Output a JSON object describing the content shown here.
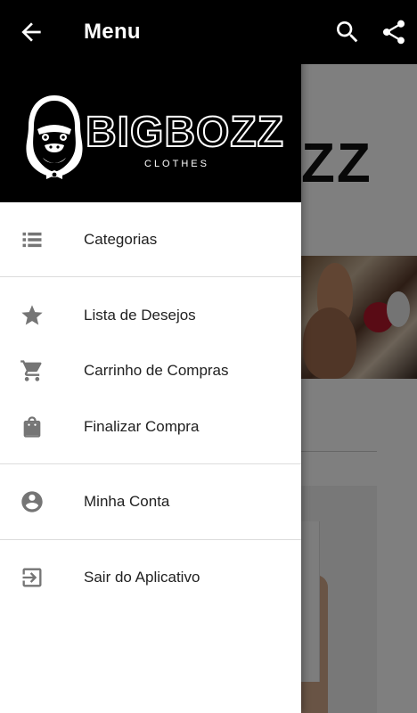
{
  "toolbar": {
    "title": "Menu",
    "icons": [
      "arrow-back-icon",
      "search-icon",
      "share-icon"
    ],
    "background": "#000000"
  },
  "drawer": {
    "header": {
      "brand": "BIGBOZZ",
      "tagline": "CLOTHES",
      "background": "#000000"
    },
    "sections": [
      {
        "items": [
          {
            "label": "Categorias",
            "icon": "list-icon"
          }
        ]
      },
      {
        "items": [
          {
            "label": "Lista de Desejos",
            "icon": "star-icon"
          },
          {
            "label": "Carrinho de Compras",
            "icon": "shopping-cart-icon"
          },
          {
            "label": "Finalizar Compra",
            "icon": "shopping-bag-icon"
          }
        ]
      },
      {
        "items": [
          {
            "label": "Minha Conta",
            "icon": "account-circle-icon"
          }
        ]
      },
      {
        "items": [
          {
            "label": "Sair do Aplicativo",
            "icon": "exit-icon"
          }
        ]
      }
    ],
    "icon_color": "#757575"
  },
  "background_content": {
    "brand_text": "ZZ"
  }
}
